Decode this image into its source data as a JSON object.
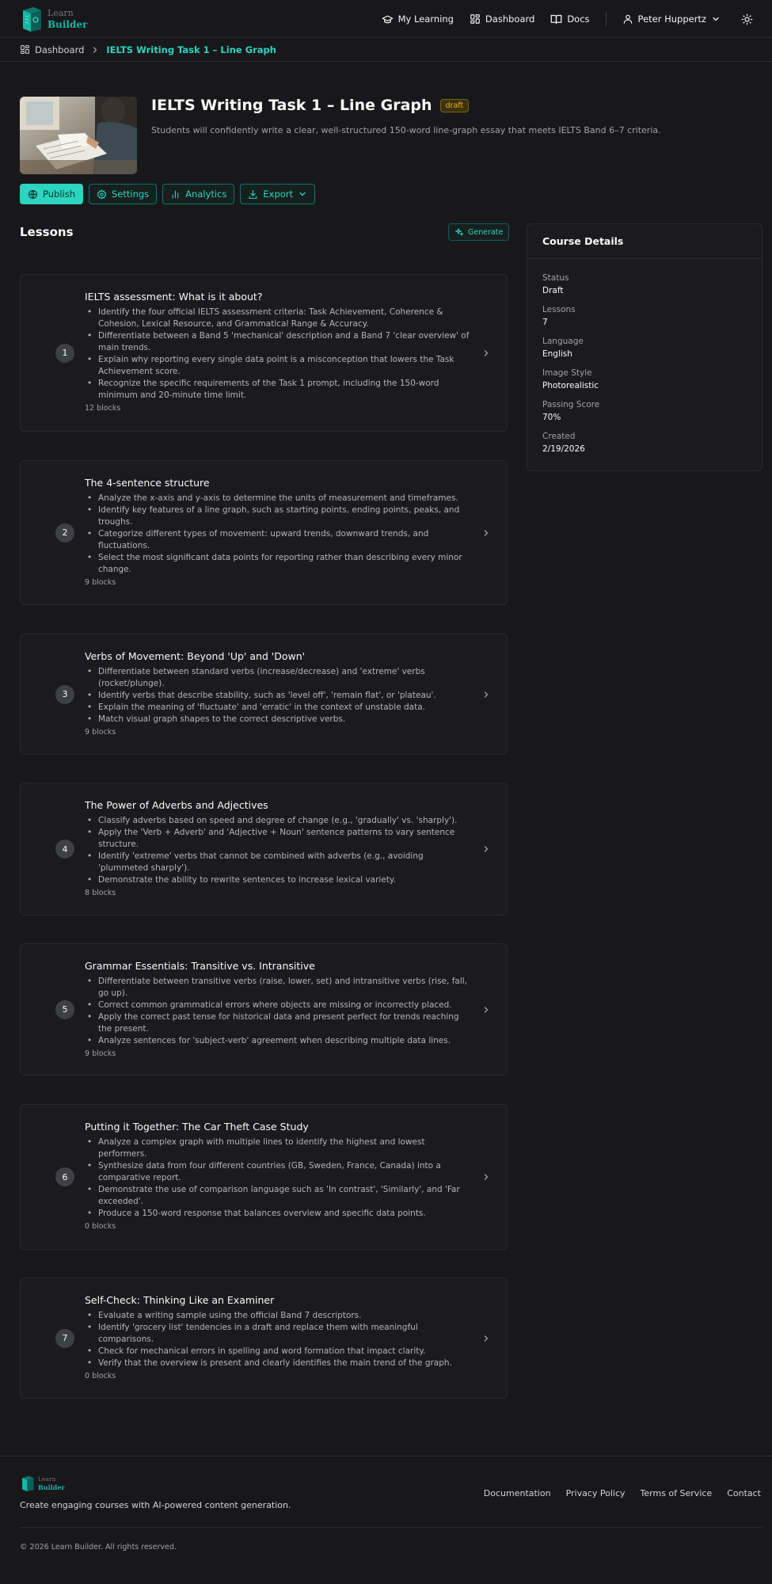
{
  "nav": {
    "logo_line1": "Learn",
    "logo_line2": "Builder",
    "links": [
      "My Learning",
      "Dashboard",
      "Docs"
    ],
    "user_name": "Peter Huppertz"
  },
  "breadcrumb": {
    "home": "Dashboard",
    "current": "IELTS Writing Task 1 – Line Graph"
  },
  "course": {
    "title": "IELTS Writing Task 1 – Line Graph",
    "status_badge": "draft",
    "description": "Students will confidently write a clear, well-structured 150-word line-graph essay that meets IELTS Band 6–7 criteria."
  },
  "actions": {
    "publish": "Publish",
    "settings": "Settings",
    "analytics": "Analytics",
    "export": "Export"
  },
  "lessons_section": {
    "title": "Lessons",
    "generate": "Generate"
  },
  "lessons": [
    {
      "number": "1",
      "title": "IELTS assessment: What is it about?",
      "objectives": [
        "Identify the four official IELTS assessment criteria: Task Achievement, Coherence & Cohesion, Lexical Resource, and Grammatical Range & Accuracy.",
        "Differentiate between a Band 5 'mechanical' description and a Band 7 'clear overview' of main trends.",
        "Explain why reporting every single data point is a misconception that lowers the Task Achievement score.",
        "Recognize the specific requirements of the Task 1 prompt, including the 150-word minimum and 20-minute time limit."
      ],
      "blocks": "12 blocks"
    },
    {
      "number": "2",
      "title": "The 4-sentence structure",
      "objectives": [
        "Analyze the x-axis and y-axis to determine the units of measurement and timeframes.",
        "Identify key features of a line graph, such as starting points, ending points, peaks, and troughs.",
        "Categorize different types of movement: upward trends, downward trends, and fluctuations.",
        "Select the most significant data points for reporting rather than describing every minor change."
      ],
      "blocks": "9 blocks"
    },
    {
      "number": "3",
      "title": "Verbs of Movement: Beyond 'Up' and 'Down'",
      "objectives": [
        "Differentiate between standard verbs (increase/decrease) and 'extreme' verbs (rocket/plunge).",
        "Identify verbs that describe stability, such as 'level off', 'remain flat', or 'plateau'.",
        "Explain the meaning of 'fluctuate' and 'erratic' in the context of unstable data.",
        "Match visual graph shapes to the correct descriptive verbs."
      ],
      "blocks": "9 blocks"
    },
    {
      "number": "4",
      "title": "The Power of Adverbs and Adjectives",
      "objectives": [
        "Classify adverbs based on speed and degree of change (e.g., 'gradually' vs. 'sharply').",
        "Apply the 'Verb + Adverb' and 'Adjective + Noun' sentence patterns to vary sentence structure.",
        "Identify 'extreme' verbs that cannot be combined with adverbs (e.g., avoiding 'plummeted sharply').",
        "Demonstrate the ability to rewrite sentences to increase lexical variety."
      ],
      "blocks": "8 blocks"
    },
    {
      "number": "5",
      "title": "Grammar Essentials: Transitive vs. Intransitive",
      "objectives": [
        "Differentiate between transitive verbs (raise, lower, set) and intransitive verbs (rise, fall, go up).",
        "Correct common grammatical errors where objects are missing or incorrectly placed.",
        "Apply the correct past tense for historical data and present perfect for trends reaching the present.",
        "Analyze sentences for 'subject-verb' agreement when describing multiple data lines."
      ],
      "blocks": "9 blocks"
    },
    {
      "number": "6",
      "title": "Putting it Together: The Car Theft Case Study",
      "objectives": [
        "Analyze a complex graph with multiple lines to identify the highest and lowest performers.",
        "Synthesize data from four different countries (GB, Sweden, France, Canada) into a comparative report.",
        "Demonstrate the use of comparison language such as 'In contrast', 'Similarly', and 'Far exceeded'.",
        "Produce a 150-word response that balances overview and specific data points."
      ],
      "blocks": "0 blocks"
    },
    {
      "number": "7",
      "title": "Self-Check: Thinking Like an Examiner",
      "objectives": [
        "Evaluate a writing sample using the official Band 7 descriptors.",
        "Identify 'grocery list' tendencies in a draft and replace them with meaningful comparisons.",
        "Check for mechanical errors in spelling and word formation that impact clarity.",
        "Verify that the overview is present and clearly identifies the main trend of the graph."
      ],
      "blocks": "0 blocks"
    }
  ],
  "details": {
    "title": "Course Details",
    "items": [
      {
        "label": "Status",
        "value": "Draft"
      },
      {
        "label": "Lessons",
        "value": "7"
      },
      {
        "label": "Language",
        "value": "English"
      },
      {
        "label": "Image Style",
        "value": "Photorealistic"
      },
      {
        "label": "Passing Score",
        "value": "70%"
      },
      {
        "label": "Created",
        "value": "2/19/2026"
      }
    ]
  },
  "footer": {
    "logo_line1": "Learn",
    "logo_line2": "Builder",
    "tagline": "Create engaging courses with AI-powered content generation.",
    "links": [
      "Documentation",
      "Privacy Policy",
      "Terms of Service",
      "Contact"
    ],
    "copyright": "© 2026 Learn Builder. All rights reserved."
  },
  "colors": {
    "accent": "#2dd4bf",
    "background": "#18181b",
    "card": "#1b1b1e",
    "draft_badge": "#eab308"
  }
}
